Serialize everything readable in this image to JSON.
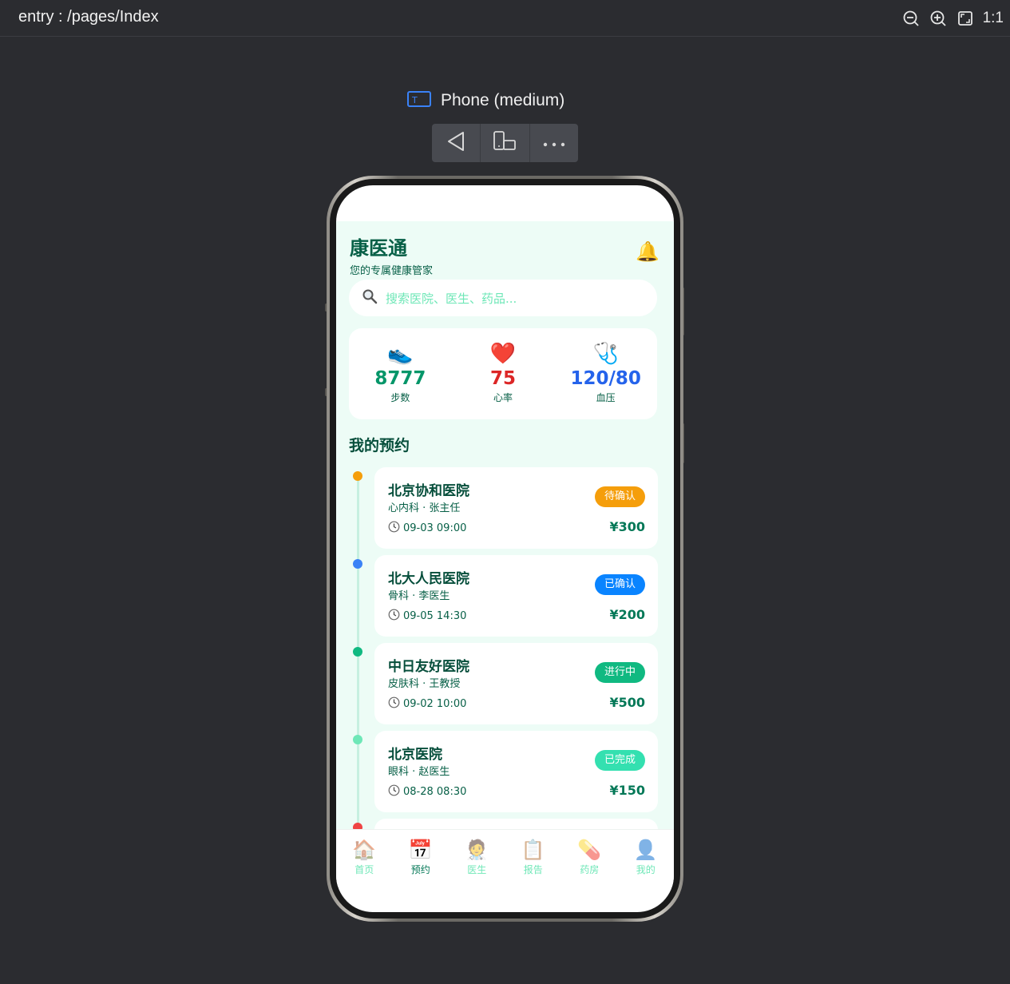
{
  "ide": {
    "route": "entry : /pages/Index",
    "tools": {
      "actual_size_label": "1:1"
    },
    "device_name": "Phone (medium)"
  },
  "app": {
    "title": "康医通",
    "subtitle": "您的专属健康管家",
    "search_placeholder": "搜索医院、医生、药品...",
    "stats": [
      {
        "icon": "sneaker-icon",
        "emoji": "👟",
        "value": "8777",
        "label": "步数",
        "color": "#059669"
      },
      {
        "icon": "heart-icon",
        "emoji": "❤️",
        "value": "75",
        "label": "心率",
        "color": "#dc2626"
      },
      {
        "icon": "stethoscope-icon",
        "emoji": "🩺",
        "value": "120/80",
        "label": "血压",
        "color": "#2563eb"
      }
    ],
    "section_title": "我的预约",
    "appointments": [
      {
        "hospital": "北京协和医院",
        "dept": "心内科 · 张主任",
        "time": "09-03 09:00",
        "status": "待确认",
        "status_color": "#f59e0b",
        "dot_color": "#f59e0b",
        "price": "¥300"
      },
      {
        "hospital": "北大人民医院",
        "dept": "骨科 · 李医生",
        "time": "09-05 14:30",
        "status": "已确认",
        "status_color": "#0a84ff",
        "dot_color": "#3b82f6",
        "price": "¥200"
      },
      {
        "hospital": "中日友好医院",
        "dept": "皮肤科 · 王教授",
        "time": "09-02 10:00",
        "status": "进行中",
        "status_color": "#10b981",
        "dot_color": "#10b981",
        "price": "¥500"
      },
      {
        "hospital": "北京医院",
        "dept": "眼科 · 赵医生",
        "time": "08-28 08:30",
        "status": "已完成",
        "status_color": "#34e0b0",
        "dot_color": "#6ee7b7",
        "price": "¥150"
      }
    ],
    "tabs": [
      {
        "label": "首页",
        "icon": "house-icon",
        "emoji": "🏠",
        "active": false
      },
      {
        "label": "预约",
        "icon": "calendar-icon",
        "emoji": "📅",
        "active": true
      },
      {
        "label": "医生",
        "icon": "doctor-icon",
        "emoji": "🧑‍⚕️",
        "active": false
      },
      {
        "label": "报告",
        "icon": "clipboard-icon",
        "emoji": "📋",
        "active": false
      },
      {
        "label": "药房",
        "icon": "pill-icon",
        "emoji": "💊",
        "active": false
      },
      {
        "label": "我的",
        "icon": "user-icon",
        "emoji": "👤",
        "active": false
      }
    ],
    "colors": {
      "accent": "#047857",
      "background": "#edfcf6",
      "title": "#065f46"
    }
  }
}
